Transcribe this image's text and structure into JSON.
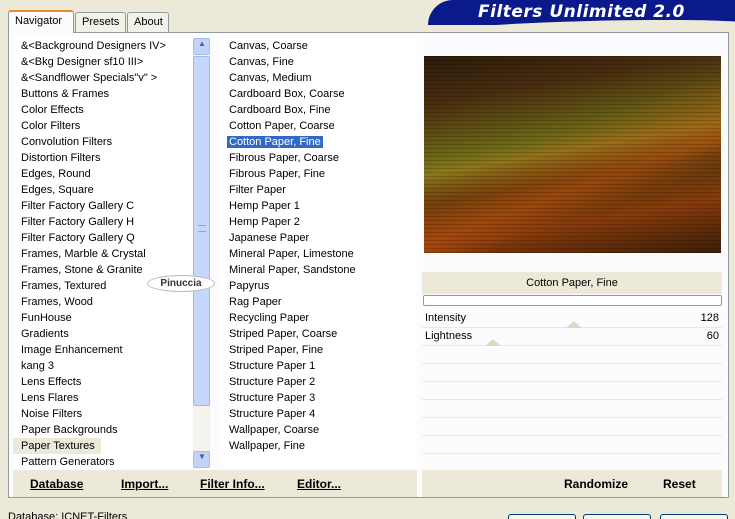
{
  "banner": {
    "title": "Filters Unlimited 2.0"
  },
  "tabs": [
    {
      "label": "Navigator",
      "active": true
    },
    {
      "label": "Presets",
      "active": false
    },
    {
      "label": "About",
      "active": false
    }
  ],
  "categories": [
    "&<Background Designers IV>",
    "&<Bkg Designer sf10 III>",
    "&<Sandflower Specials\"v\" >",
    "Buttons & Frames",
    "Color Effects",
    "Color Filters",
    "Convolution Filters",
    "Distortion Filters",
    "Edges, Round",
    "Edges, Square",
    "Filter Factory Gallery C",
    "Filter Factory Gallery H",
    "Filter Factory Gallery Q",
    "Frames, Marble & Crystal",
    "Frames, Stone & Granite",
    "Frames, Textured",
    "Frames, Wood",
    "FunHouse",
    "Gradients",
    "Image Enhancement",
    "kang 3",
    "Lens Effects",
    "Lens Flares",
    "Noise Filters",
    "Paper Backgrounds",
    "Paper Textures",
    "Pattern Generators"
  ],
  "selected_category": "Paper Textures",
  "filters": [
    "Canvas, Coarse",
    "Canvas, Fine",
    "Canvas, Medium",
    "Cardboard Box, Coarse",
    "Cardboard Box, Fine",
    "Cotton Paper, Coarse",
    "Cotton Paper, Fine",
    "Fibrous Paper, Coarse",
    "Fibrous Paper, Fine",
    "Filter Paper",
    "Hemp Paper 1",
    "Hemp Paper 2",
    "Japanese Paper",
    "Mineral Paper, Limestone",
    "Mineral Paper, Sandstone",
    "Papyrus",
    "Rag Paper",
    "Recycling Paper",
    "Striped Paper, Coarse",
    "Striped Paper, Fine",
    "Structure Paper 1",
    "Structure Paper 2",
    "Structure Paper 3",
    "Structure Paper 4",
    "Wallpaper, Coarse",
    "Wallpaper, Fine"
  ],
  "selected_filter": "Cotton Paper, Fine",
  "watermark": "Pinuccia",
  "sliders": [
    {
      "label": "Intensity",
      "value": "128"
    },
    {
      "label": "Lightness",
      "value": "60"
    }
  ],
  "buttons": {
    "database": "Database",
    "import": "Import...",
    "filter_info": "Filter Info...",
    "editor": "Editor...",
    "randomize": "Randomize",
    "reset": "Reset"
  },
  "status": "Database:  ICNET-Filters",
  "colors": {
    "selection": "#316ac5",
    "banner": "#0a1a8a",
    "tab_accent": "#e68b2c"
  }
}
